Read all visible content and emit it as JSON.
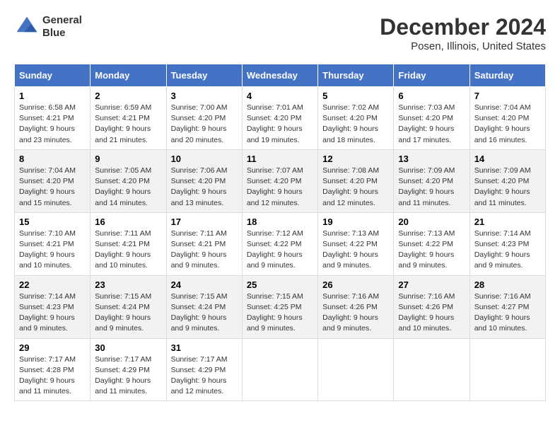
{
  "header": {
    "logo_line1": "General",
    "logo_line2": "Blue",
    "title": "December 2024",
    "subtitle": "Posen, Illinois, United States"
  },
  "calendar": {
    "days_of_week": [
      "Sunday",
      "Monday",
      "Tuesday",
      "Wednesday",
      "Thursday",
      "Friday",
      "Saturday"
    ],
    "weeks": [
      [
        {
          "day": "1",
          "info": "Sunrise: 6:58 AM\nSunset: 4:21 PM\nDaylight: 9 hours\nand 23 minutes."
        },
        {
          "day": "2",
          "info": "Sunrise: 6:59 AM\nSunset: 4:21 PM\nDaylight: 9 hours\nand 21 minutes."
        },
        {
          "day": "3",
          "info": "Sunrise: 7:00 AM\nSunset: 4:20 PM\nDaylight: 9 hours\nand 20 minutes."
        },
        {
          "day": "4",
          "info": "Sunrise: 7:01 AM\nSunset: 4:20 PM\nDaylight: 9 hours\nand 19 minutes."
        },
        {
          "day": "5",
          "info": "Sunrise: 7:02 AM\nSunset: 4:20 PM\nDaylight: 9 hours\nand 18 minutes."
        },
        {
          "day": "6",
          "info": "Sunrise: 7:03 AM\nSunset: 4:20 PM\nDaylight: 9 hours\nand 17 minutes."
        },
        {
          "day": "7",
          "info": "Sunrise: 7:04 AM\nSunset: 4:20 PM\nDaylight: 9 hours\nand 16 minutes."
        }
      ],
      [
        {
          "day": "8",
          "info": "Sunrise: 7:04 AM\nSunset: 4:20 PM\nDaylight: 9 hours\nand 15 minutes."
        },
        {
          "day": "9",
          "info": "Sunrise: 7:05 AM\nSunset: 4:20 PM\nDaylight: 9 hours\nand 14 minutes."
        },
        {
          "day": "10",
          "info": "Sunrise: 7:06 AM\nSunset: 4:20 PM\nDaylight: 9 hours\nand 13 minutes."
        },
        {
          "day": "11",
          "info": "Sunrise: 7:07 AM\nSunset: 4:20 PM\nDaylight: 9 hours\nand 12 minutes."
        },
        {
          "day": "12",
          "info": "Sunrise: 7:08 AM\nSunset: 4:20 PM\nDaylight: 9 hours\nand 12 minutes."
        },
        {
          "day": "13",
          "info": "Sunrise: 7:09 AM\nSunset: 4:20 PM\nDaylight: 9 hours\nand 11 minutes."
        },
        {
          "day": "14",
          "info": "Sunrise: 7:09 AM\nSunset: 4:20 PM\nDaylight: 9 hours\nand 11 minutes."
        }
      ],
      [
        {
          "day": "15",
          "info": "Sunrise: 7:10 AM\nSunset: 4:21 PM\nDaylight: 9 hours\nand 10 minutes."
        },
        {
          "day": "16",
          "info": "Sunrise: 7:11 AM\nSunset: 4:21 PM\nDaylight: 9 hours\nand 10 minutes."
        },
        {
          "day": "17",
          "info": "Sunrise: 7:11 AM\nSunset: 4:21 PM\nDaylight: 9 hours\nand 9 minutes."
        },
        {
          "day": "18",
          "info": "Sunrise: 7:12 AM\nSunset: 4:22 PM\nDaylight: 9 hours\nand 9 minutes."
        },
        {
          "day": "19",
          "info": "Sunrise: 7:13 AM\nSunset: 4:22 PM\nDaylight: 9 hours\nand 9 minutes."
        },
        {
          "day": "20",
          "info": "Sunrise: 7:13 AM\nSunset: 4:22 PM\nDaylight: 9 hours\nand 9 minutes."
        },
        {
          "day": "21",
          "info": "Sunrise: 7:14 AM\nSunset: 4:23 PM\nDaylight: 9 hours\nand 9 minutes."
        }
      ],
      [
        {
          "day": "22",
          "info": "Sunrise: 7:14 AM\nSunset: 4:23 PM\nDaylight: 9 hours\nand 9 minutes."
        },
        {
          "day": "23",
          "info": "Sunrise: 7:15 AM\nSunset: 4:24 PM\nDaylight: 9 hours\nand 9 minutes."
        },
        {
          "day": "24",
          "info": "Sunrise: 7:15 AM\nSunset: 4:24 PM\nDaylight: 9 hours\nand 9 minutes."
        },
        {
          "day": "25",
          "info": "Sunrise: 7:15 AM\nSunset: 4:25 PM\nDaylight: 9 hours\nand 9 minutes."
        },
        {
          "day": "26",
          "info": "Sunrise: 7:16 AM\nSunset: 4:26 PM\nDaylight: 9 hours\nand 9 minutes."
        },
        {
          "day": "27",
          "info": "Sunrise: 7:16 AM\nSunset: 4:26 PM\nDaylight: 9 hours\nand 10 minutes."
        },
        {
          "day": "28",
          "info": "Sunrise: 7:16 AM\nSunset: 4:27 PM\nDaylight: 9 hours\nand 10 minutes."
        }
      ],
      [
        {
          "day": "29",
          "info": "Sunrise: 7:17 AM\nSunset: 4:28 PM\nDaylight: 9 hours\nand 11 minutes."
        },
        {
          "day": "30",
          "info": "Sunrise: 7:17 AM\nSunset: 4:29 PM\nDaylight: 9 hours\nand 11 minutes."
        },
        {
          "day": "31",
          "info": "Sunrise: 7:17 AM\nSunset: 4:29 PM\nDaylight: 9 hours\nand 12 minutes."
        },
        {
          "day": "",
          "info": ""
        },
        {
          "day": "",
          "info": ""
        },
        {
          "day": "",
          "info": ""
        },
        {
          "day": "",
          "info": ""
        }
      ]
    ]
  }
}
